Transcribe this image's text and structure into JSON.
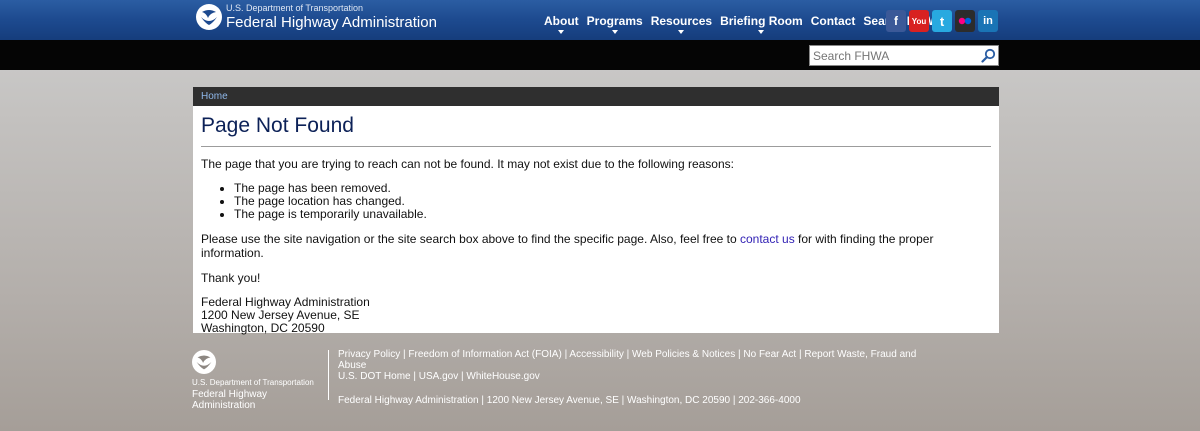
{
  "header": {
    "brand_sub": "U.S. Department of Transportation",
    "brand_main": "Federal Highway Administration",
    "nav": [
      {
        "label": "About",
        "has_dropdown": true
      },
      {
        "label": "Programs",
        "has_dropdown": true
      },
      {
        "label": "Resources",
        "has_dropdown": true
      },
      {
        "label": "Briefing Room",
        "has_dropdown": true
      },
      {
        "label": "Contact",
        "has_dropdown": false
      },
      {
        "label": "Search FHWA",
        "has_dropdown": false
      }
    ],
    "social": [
      {
        "icon": "facebook-icon",
        "glyph": "f",
        "color": "#3b5998"
      },
      {
        "icon": "youtube-icon",
        "glyph": "You",
        "color": "#d82121"
      },
      {
        "icon": "twitter-icon",
        "glyph": "t",
        "color": "#28a9e0"
      },
      {
        "icon": "flickr-icon",
        "glyph": "●●",
        "color": "#2c2c2c"
      },
      {
        "icon": "linkedin-icon",
        "glyph": "in",
        "color": "#1a74b5"
      }
    ]
  },
  "search": {
    "placeholder": "Search FHWA"
  },
  "breadcrumb": {
    "home": "Home"
  },
  "page": {
    "title": "Page Not Found",
    "intro": "The page that you are trying to reach can not be found. It may not exist due to the following reasons:",
    "reasons": [
      "The page has been removed.",
      "The page location has changed.",
      "The page is temporarily unavailable."
    ],
    "help_before": "Please use the site navigation or the site search box above to find the specific page. Also, feel free to ",
    "help_link": "contact us",
    "help_after": " for with finding the proper information.",
    "thanks": "Thank you!",
    "address": [
      "Federal Highway Administration",
      "1200 New Jersey Avenue, SE",
      "Washington, DC 20590"
    ]
  },
  "footer": {
    "logo_sub": "U.S. Department of Transportation",
    "logo_main": "Federal Highway Administration",
    "links_row1": [
      "Privacy Policy",
      "Freedom of Information Act (FOIA)",
      "Accessibility",
      "Web Policies & Notices",
      "No Fear Act",
      "Report Waste, Fraud and Abuse"
    ],
    "links_row2": [
      "U.S. DOT Home",
      "USA.gov",
      "WhiteHouse.gov"
    ],
    "address_line": "Federal Highway Administration | 1200 New Jersey Avenue, SE | Washington, DC 20590 | 202-366-4000"
  },
  "colors": {
    "header_blue": "#1d4a8f",
    "title_navy": "#0c2157",
    "link_purple": "#3222b5",
    "breadcrumb_link": "#8fb8ea"
  }
}
